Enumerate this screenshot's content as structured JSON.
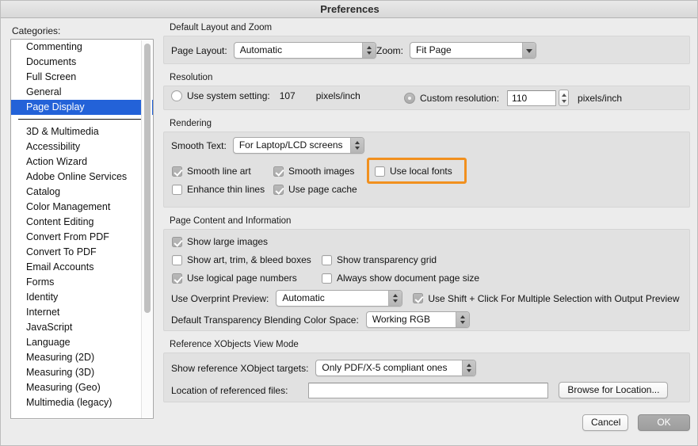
{
  "window": {
    "title": "Preferences"
  },
  "sidebar": {
    "label": "Categories:",
    "items": [
      {
        "label": "Commenting",
        "selected": false
      },
      {
        "label": "Documents",
        "selected": false
      },
      {
        "label": "Full Screen",
        "selected": false
      },
      {
        "label": "General",
        "selected": false
      },
      {
        "label": "Page Display",
        "selected": true
      }
    ],
    "items2": [
      {
        "label": "3D & Multimedia"
      },
      {
        "label": "Accessibility"
      },
      {
        "label": "Action Wizard"
      },
      {
        "label": "Adobe Online Services"
      },
      {
        "label": "Catalog"
      },
      {
        "label": "Color Management"
      },
      {
        "label": "Content Editing"
      },
      {
        "label": "Convert From PDF"
      },
      {
        "label": "Convert To PDF"
      },
      {
        "label": "Email Accounts"
      },
      {
        "label": "Forms"
      },
      {
        "label": "Identity"
      },
      {
        "label": "Internet"
      },
      {
        "label": "JavaScript"
      },
      {
        "label": "Language"
      },
      {
        "label": "Measuring (2D)"
      },
      {
        "label": "Measuring (3D)"
      },
      {
        "label": "Measuring (Geo)"
      },
      {
        "label": "Multimedia (legacy)"
      }
    ]
  },
  "layout_zoom": {
    "group_title": "Default Layout and Zoom",
    "page_layout_label": "Page Layout:",
    "page_layout_value": "Automatic",
    "zoom_label": "Zoom:",
    "zoom_value": "Fit Page"
  },
  "resolution": {
    "group_title": "Resolution",
    "system_radio_label": "Use system setting:",
    "system_value": "107",
    "system_unit": "pixels/inch",
    "custom_radio_label": "Custom resolution:",
    "custom_value": "110",
    "custom_unit": "pixels/inch",
    "system_selected": false,
    "custom_selected": true
  },
  "rendering": {
    "group_title": "Rendering",
    "smooth_text_label": "Smooth Text:",
    "smooth_text_value": "For Laptop/LCD screens",
    "checks": {
      "smooth_line_art": {
        "label": "Smooth line art",
        "checked": true
      },
      "smooth_images": {
        "label": "Smooth images",
        "checked": true
      },
      "use_local_fonts": {
        "label": "Use local fonts",
        "checked": false
      },
      "enhance_thin_lines": {
        "label": "Enhance thin lines",
        "checked": false
      },
      "use_page_cache": {
        "label": "Use page cache",
        "checked": true
      }
    }
  },
  "page_content": {
    "group_title": "Page Content and Information",
    "checks": {
      "show_large_images": {
        "label": "Show large images",
        "checked": true
      },
      "show_art_trim_bleed": {
        "label": "Show art, trim, & bleed boxes",
        "checked": false
      },
      "show_transparency_grid": {
        "label": "Show transparency grid",
        "checked": false
      },
      "use_logical_page_numbers": {
        "label": "Use logical page numbers",
        "checked": true
      },
      "always_show_doc_page_size": {
        "label": "Always show document page size",
        "checked": false
      },
      "use_shift_click": {
        "label": "Use Shift + Click For Multiple Selection with Output Preview",
        "checked": true
      }
    },
    "overprint_label": "Use Overprint Preview:",
    "overprint_value": "Automatic",
    "blending_label": "Default Transparency Blending Color Space:",
    "blending_value": "Working RGB"
  },
  "reference_xobjects": {
    "group_title": "Reference XObjects View Mode",
    "targets_label": "Show reference XObject targets:",
    "targets_value": "Only PDF/X-5 compliant ones",
    "location_label": "Location of referenced files:",
    "location_value": "",
    "location_placeholder": "",
    "browse_button": "Browse for Location..."
  },
  "footer": {
    "cancel_label": "Cancel",
    "ok_label": "OK"
  },
  "colors": {
    "selection_blue": "#2362d8",
    "highlight_orange": "#f1901e",
    "group_bg": "#e1e1e1",
    "window_bg": "#ececec"
  }
}
